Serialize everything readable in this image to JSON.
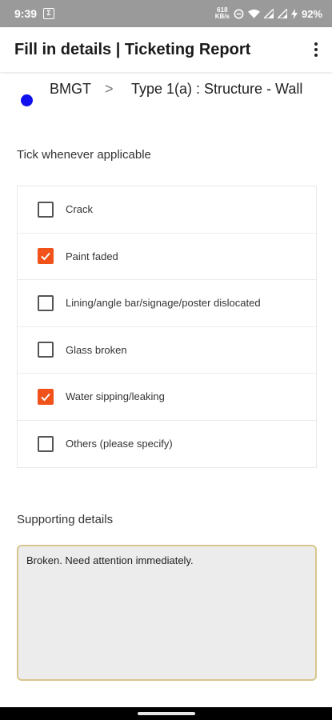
{
  "status_bar": {
    "time": "9:39",
    "notification_glyph": "Σ",
    "speed_value": "618",
    "speed_unit": "KB/s",
    "battery": "92%",
    "icons": [
      "dnd-icon",
      "wifi-icon",
      "signal-icon",
      "signal-icon",
      "charging-icon"
    ]
  },
  "app_bar": {
    "title": "Fill in details | Ticketing Report"
  },
  "breadcrumb": {
    "root": "BMGT",
    "separator": ">",
    "current": "Type 1(a) :  Structure - Wall",
    "dot_color": "#1010ee"
  },
  "checklist": {
    "heading": "Tick whenever applicable",
    "items": [
      {
        "label": "Crack",
        "checked": false
      },
      {
        "label": "Paint faded",
        "checked": true
      },
      {
        "label": "Lining/angle bar/signage/poster dislocated",
        "checked": false
      },
      {
        "label": "Glass broken",
        "checked": false
      },
      {
        "label": "Water sipping/leaking",
        "checked": true
      },
      {
        "label": "Others (please specify)",
        "checked": false
      }
    ],
    "checked_color": "#f0521a"
  },
  "supporting_details": {
    "heading": "Supporting details",
    "value": "Broken. Need attention immediately."
  }
}
